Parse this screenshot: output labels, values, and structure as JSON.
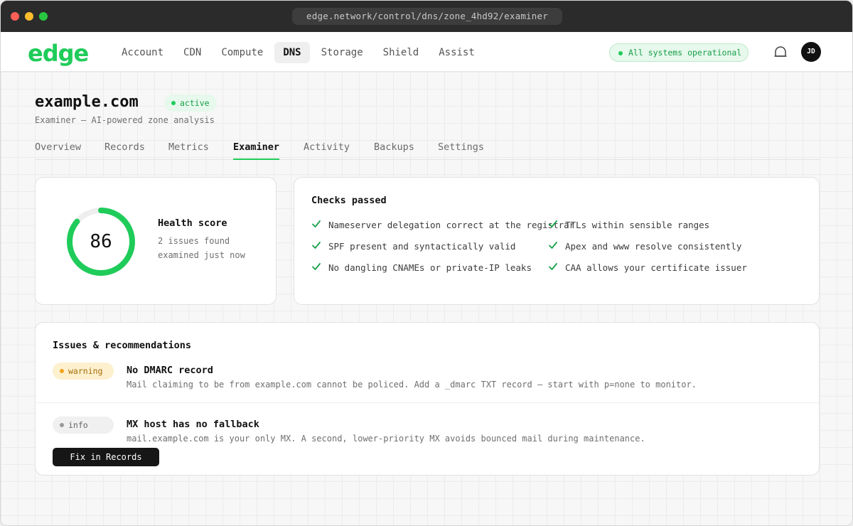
{
  "browser": {
    "url": "edge.network/control/dns/zone_4hd92/examiner"
  },
  "brand": {
    "logo_text": "edge",
    "accent": "#1fcc5a"
  },
  "nav": {
    "items": [
      "Account",
      "CDN",
      "Compute",
      "DNS",
      "Storage",
      "Shield",
      "Assist"
    ],
    "active": "DNS",
    "status": "All systems operational",
    "avatar_initials": "JD"
  },
  "zone": {
    "name": "example.com",
    "status": "active",
    "subtitle": "Examiner — AI-powered zone analysis"
  },
  "tabs": [
    "Overview",
    "Records",
    "Metrics",
    "Examiner",
    "Activity",
    "Backups",
    "Settings"
  ],
  "active_tab": "Examiner",
  "health": {
    "score": "86",
    "score_fraction": 0.86,
    "title": "Health score",
    "issues": "2 issues found",
    "examined": "examined just now"
  },
  "checks": {
    "title": "Checks passed",
    "left": [
      "Nameserver delegation correct at the registrar",
      "SPF present and syntactically valid",
      "No dangling CNAMEs or private-IP leaks"
    ],
    "right": [
      "TTLs within sensible ranges",
      "Apex and www resolve consistently",
      "CAA allows your certificate issuer"
    ]
  },
  "issues": {
    "title": "Issues & recommendations",
    "items": [
      {
        "severity": "warning",
        "title": "No DMARC record",
        "description": "Mail claiming to be from example.com cannot be policed. Add a _dmarc TXT record — start with p=none to monitor."
      },
      {
        "severity": "info",
        "title": "MX host has no fallback",
        "description": "mail.example.com is your only MX. A second, lower-priority MX avoids bounced mail during maintenance."
      }
    ],
    "fix_button": "Fix in Records"
  },
  "icons": {
    "bell": "bell-icon",
    "check": "check-icon"
  }
}
